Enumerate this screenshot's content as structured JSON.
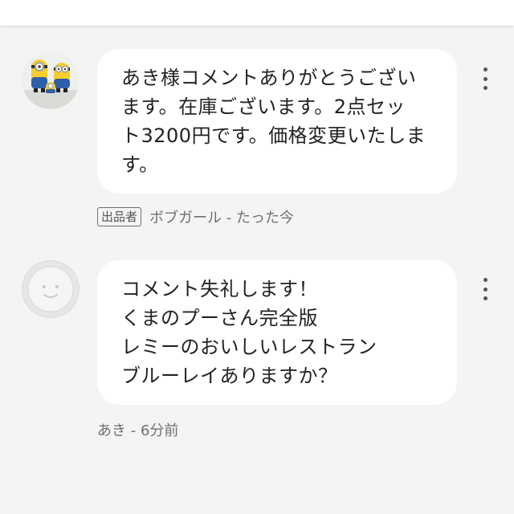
{
  "comments": [
    {
      "lines": [
        "あき様コメントありがとうござい",
        "ます。在庫ございます。2点セッ",
        "ト3200円です。価格変更いたしま",
        "す。"
      ],
      "badge": "出品者",
      "meta": "ボブガール - たった今",
      "avatar_icon": "minion-avatar"
    },
    {
      "lines": [
        "コメント失礼します！",
        "くまのプーさん完全版",
        "レミーのおいしいレストラン",
        "ブルーレイありますか？"
      ],
      "meta": "あき - 6分前",
      "avatar_icon": "default-face-avatar"
    }
  ],
  "colors": {
    "background": "#f4f4f4",
    "bubble": "#ffffff",
    "text": "#222222",
    "meta_text": "#707070"
  }
}
